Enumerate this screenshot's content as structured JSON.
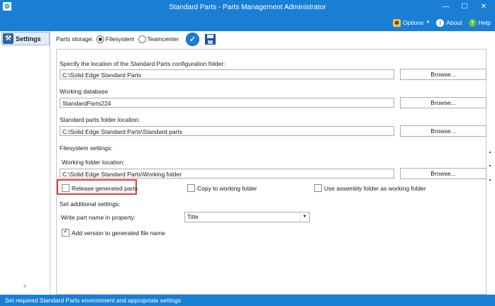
{
  "window": {
    "title": "Standard Parts - Parts Management Administrator",
    "menu": {
      "options": "Options",
      "about": "About",
      "help": "Help"
    }
  },
  "sidebar": {
    "settings_label": "Settings"
  },
  "toolbar": {
    "storage_label": "Parts storage:",
    "filesystem": "Filesystem",
    "teamcenter": "Teamcenter",
    "selected": "Filesystem"
  },
  "config_folder": {
    "label": "Specify the location of the Standard Parts configuration folder:",
    "value": "C:\\Solid Edge Standard Parts",
    "browse": "Browse..."
  },
  "working_db": {
    "label": "Working database",
    "value": "StandardParts224",
    "browse": "Browse..."
  },
  "parts_folder": {
    "label": "Standard parts folder location:",
    "value": "C:\\Solid Edge Standard Parts\\Standard parts",
    "browse": "Browse..."
  },
  "filesystem_settings": {
    "label": "Filesystem settings:",
    "working_folder_label": "Working folder location:",
    "working_folder_value": "C:\\Solid Edge Standard Parts\\Working folder",
    "browse": "Browse...",
    "release_parts": "Release generated parts",
    "release_parts_checked": false,
    "copy_to_working": "Copy to working folder",
    "copy_to_working_checked": false,
    "use_assembly_folder": "Use assembly folder as working folder",
    "use_assembly_folder_checked": false
  },
  "additional_settings": {
    "label": "Set additional settings:",
    "write_part_name_label": "Write part name in property:",
    "write_part_name_value": "Title",
    "add_version": "Add version to generated file name",
    "add_version_checked": true
  },
  "status": {
    "text": "Set required Standard Parts environment and appropriate settings"
  },
  "colors": {
    "accent": "#1a7fd4",
    "highlight": "#e0403a"
  }
}
